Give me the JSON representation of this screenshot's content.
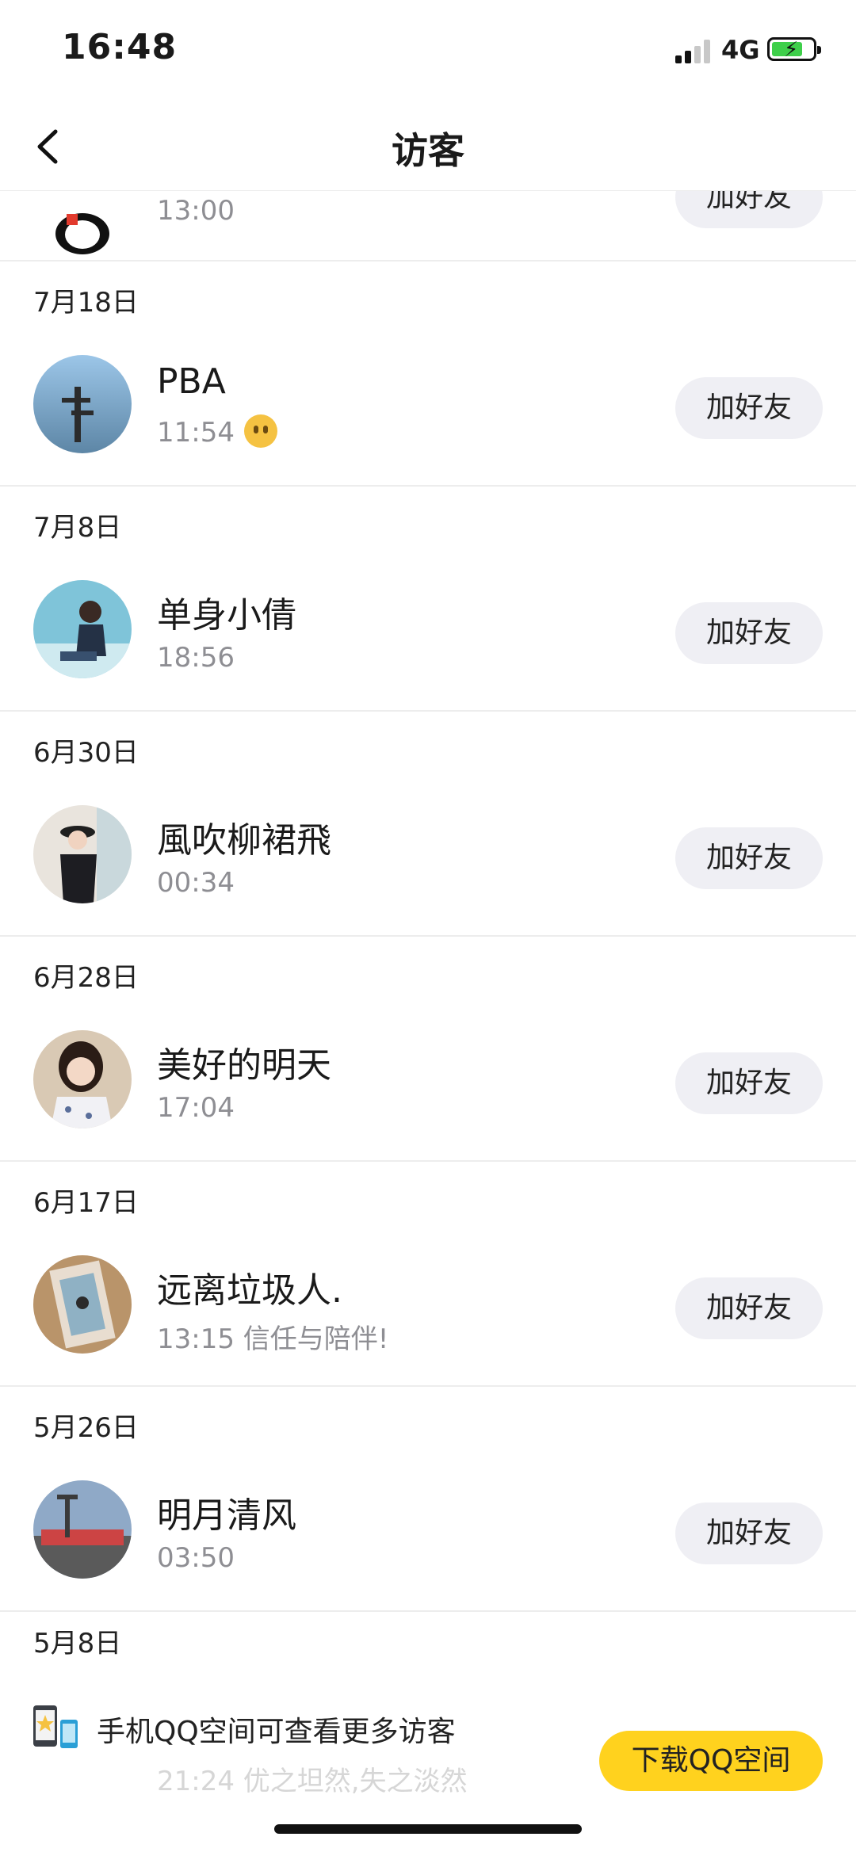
{
  "status_bar": {
    "time": "16:48",
    "network": "4G"
  },
  "header": {
    "title": "访客"
  },
  "top_partial": {
    "time": "13:00",
    "add_label": "加好友"
  },
  "groups": [
    {
      "date": "7月18日",
      "name": "PBA",
      "time": "11:54",
      "extra": "",
      "has_emoji": true,
      "add_label": "加好友"
    },
    {
      "date": "7月8日",
      "name": "单身小倩",
      "time": "18:56",
      "extra": "",
      "add_label": "加好友"
    },
    {
      "date": "6月30日",
      "name": "風吹柳裙飛",
      "time": "00:34",
      "extra": "",
      "add_label": "加好友"
    },
    {
      "date": "6月28日",
      "name": "美好的明天",
      "time": "17:04",
      "extra": "",
      "add_label": "加好友"
    },
    {
      "date": "6月17日",
      "name": "远离垃圾人.",
      "time": "13:15",
      "extra": "信任与陪伴!",
      "add_label": "加好友"
    },
    {
      "date": "5月26日",
      "name": "明月清风",
      "time": "03:50",
      "extra": "",
      "add_label": "加好友"
    }
  ],
  "last_group": {
    "date": "5月8日",
    "partial_text": "21:24 优之坦然,失之淡然"
  },
  "banner": {
    "text": "手机QQ空间可查看更多访客",
    "download_label": "下载QQ空间"
  },
  "colors": {
    "accent": "#ffd21e",
    "button_bg": "#efeff4",
    "secondary_text": "#8e8e93",
    "divider": "#ededed"
  }
}
